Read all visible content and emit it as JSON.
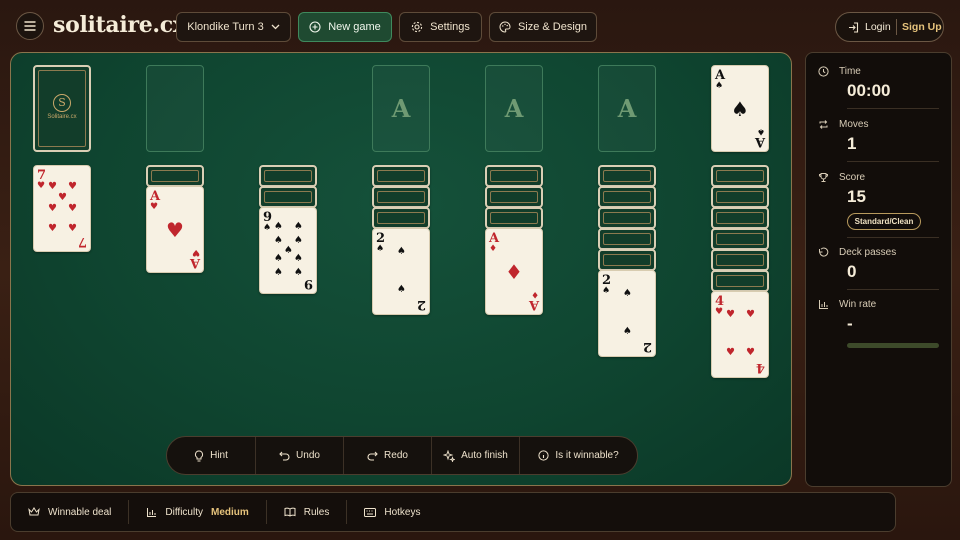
{
  "header": {
    "logo": "solitaire.cx",
    "variant": "Klondike Turn 3",
    "new_game": "New game",
    "settings": "Settings",
    "size_design": "Size & Design",
    "login": "Login",
    "signup": "Sign Up"
  },
  "stock": {
    "brand": "Solitaire.cx",
    "medal": "S"
  },
  "foundations": [
    "A",
    "A",
    "A"
  ],
  "foundation_card": {
    "rank": "A",
    "suit": "♠"
  },
  "tableau": [
    {
      "rank": "7",
      "suit": "♥"
    },
    {
      "rank": "A",
      "suit": "♥"
    },
    {
      "rank": "9",
      "suit": "♠"
    },
    {
      "rank": "2",
      "suit": "♠"
    },
    {
      "rank": "A",
      "suit": "♦"
    },
    {
      "rank": "2",
      "suit": "♠"
    },
    {
      "rank": "4",
      "suit": "♥"
    }
  ],
  "toolbar": {
    "hint": "Hint",
    "undo": "Undo",
    "redo": "Redo",
    "auto_finish": "Auto finish",
    "winnable": "Is it winnable?"
  },
  "stats": {
    "time_label": "Time",
    "time": "00:00",
    "moves_label": "Moves",
    "moves": "1",
    "score_label": "Score",
    "score": "15",
    "score_mode": "Standard/Clean",
    "passes_label": "Deck passes",
    "passes": "0",
    "winrate_label": "Win rate",
    "winrate": "-"
  },
  "footer": {
    "winnable": "Winnable deal",
    "difficulty_label": "Difficulty",
    "difficulty": "Medium",
    "rules": "Rules",
    "hotkeys": "Hotkeys"
  },
  "colors": {
    "felt": "#0f4530",
    "accent": "#e6c37c",
    "red_suit": "#c0262d"
  }
}
